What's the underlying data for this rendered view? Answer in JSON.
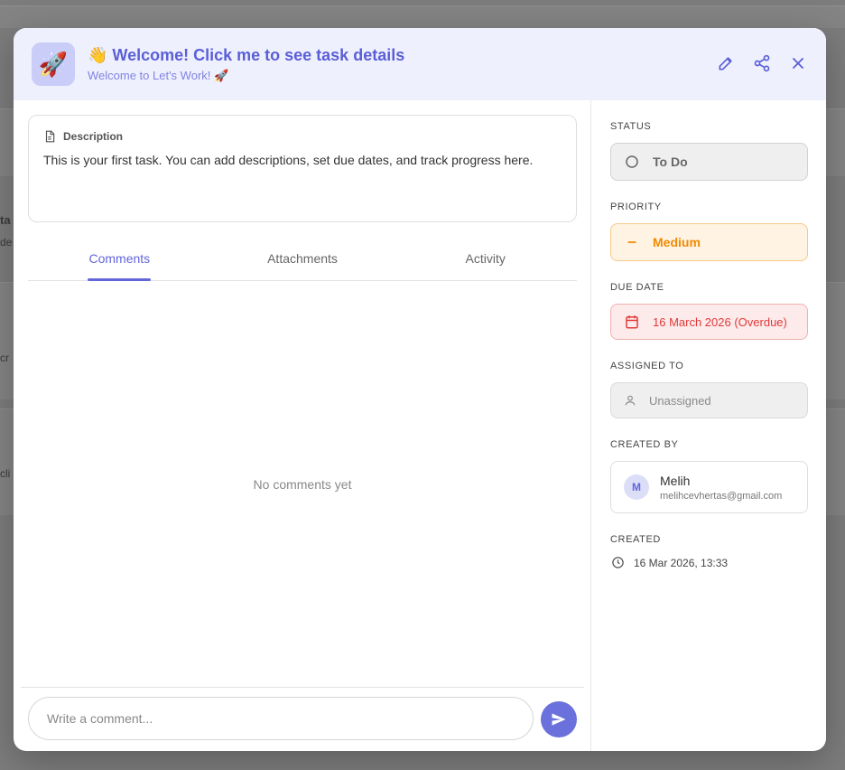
{
  "background": {
    "fragments": [
      "ta",
      "de",
      "cr",
      "cli"
    ]
  },
  "header": {
    "icon": "rocket-icon",
    "title": "👋 Welcome! Click me to see task details",
    "subtitle": "Welcome to Let's Work! 🚀",
    "actions": [
      "edit-icon",
      "share-icon",
      "close-icon"
    ]
  },
  "description": {
    "label": "Description",
    "text": "This is your first task. You can add descriptions, set due dates, and track progress here."
  },
  "tabs": [
    {
      "label": "Comments",
      "active": true
    },
    {
      "label": "Attachments",
      "active": false
    },
    {
      "label": "Activity",
      "active": false
    }
  ],
  "comments": {
    "empty_text": "No comments yet",
    "input_placeholder": "Write a comment..."
  },
  "details": {
    "status": {
      "label": "STATUS",
      "value": "To Do"
    },
    "priority": {
      "label": "PRIORITY",
      "value": "Medium"
    },
    "due_date": {
      "label": "DUE DATE",
      "value": "16 March 2026 (Overdue)"
    },
    "assigned_to": {
      "label": "ASSIGNED TO",
      "value": "Unassigned"
    },
    "created_by": {
      "label": "CREATED BY",
      "avatar_initial": "M",
      "name": "Melih",
      "email": "melihcevhertas@gmail.com"
    },
    "created": {
      "label": "CREATED",
      "value": "16 Mar 2026, 13:33"
    }
  },
  "colors": {
    "accent": "#6366d9",
    "priority": "#f08b00",
    "overdue": "#e03a3a"
  }
}
